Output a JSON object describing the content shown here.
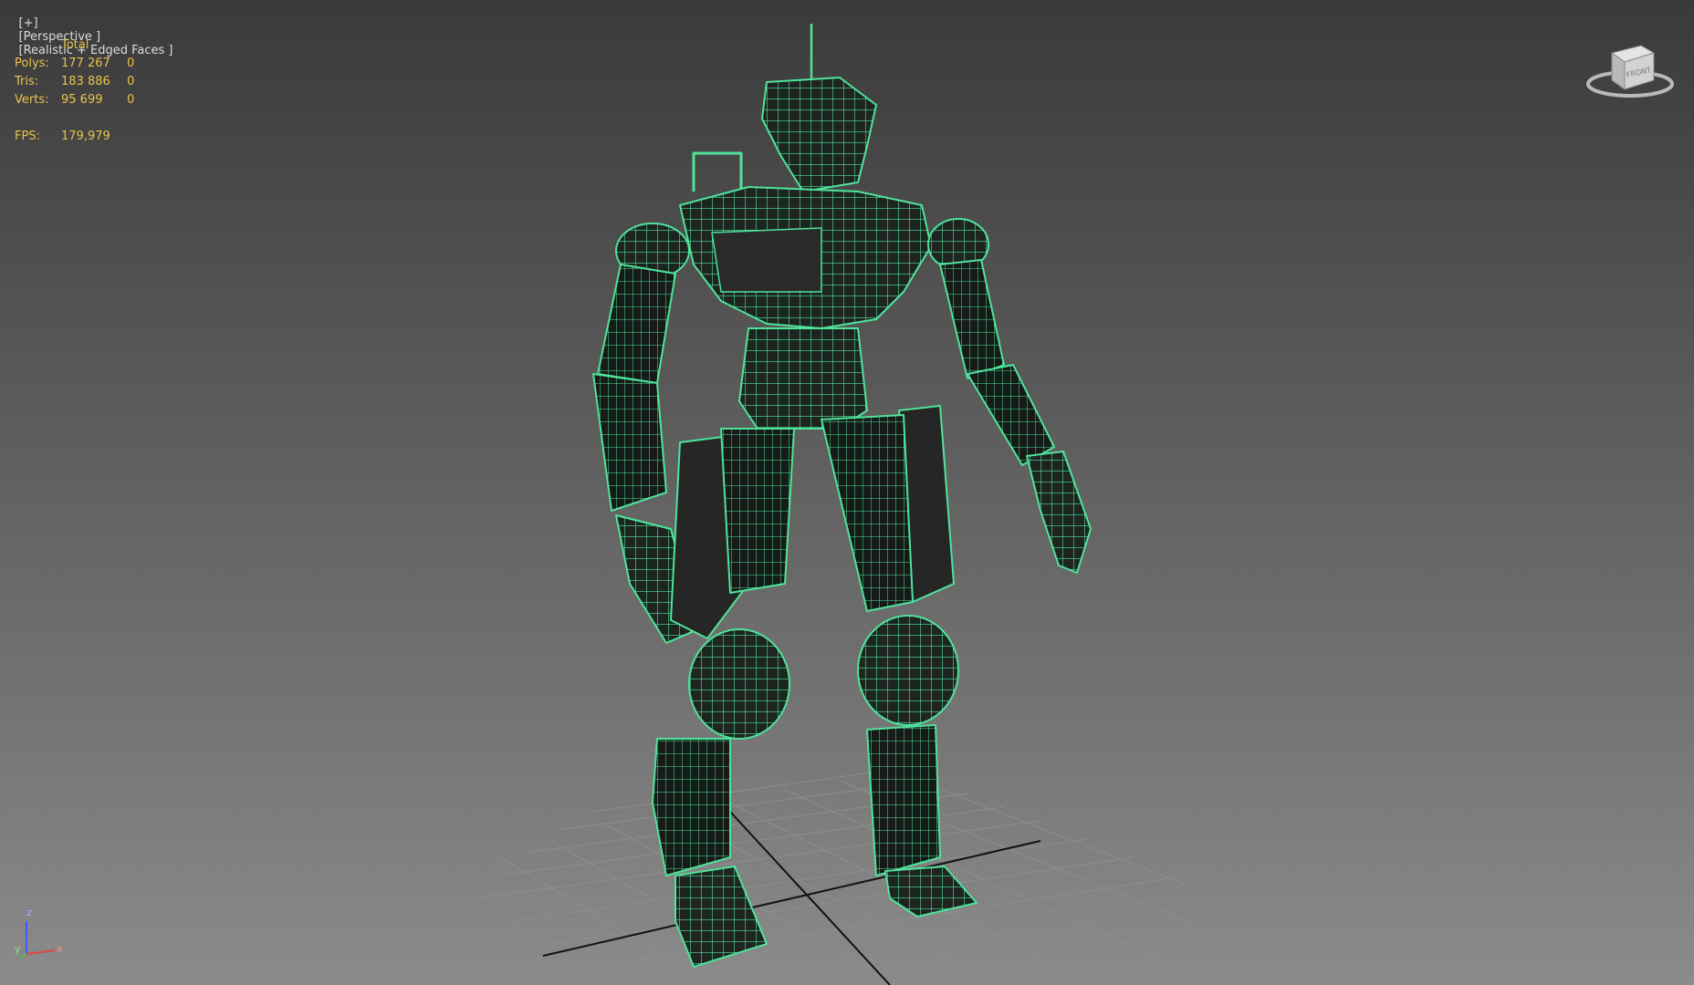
{
  "viewport": {
    "label_plus": "[+]",
    "label_view": "[Perspective ]",
    "label_shading": "[Realistic + Edged Faces ]"
  },
  "stats": {
    "header": "Total",
    "polys_label": "Polys:",
    "polys_total": "177 267",
    "polys_sel": "0",
    "tris_label": "Tris:",
    "tris_total": "183 886",
    "tris_sel": "0",
    "verts_label": "Verts:",
    "verts_total": "95 699",
    "verts_sel": "0",
    "fps_label": "FPS:",
    "fps_value": "179,979"
  },
  "viewcube": {
    "face_label": "FRONT"
  },
  "axis": {
    "x_label": "x",
    "y_label": "y",
    "z_label": "z"
  },
  "colors": {
    "wire": "#4fe39a",
    "stats_text": "#e8c44a",
    "body_dark": "#1c1c1c"
  }
}
